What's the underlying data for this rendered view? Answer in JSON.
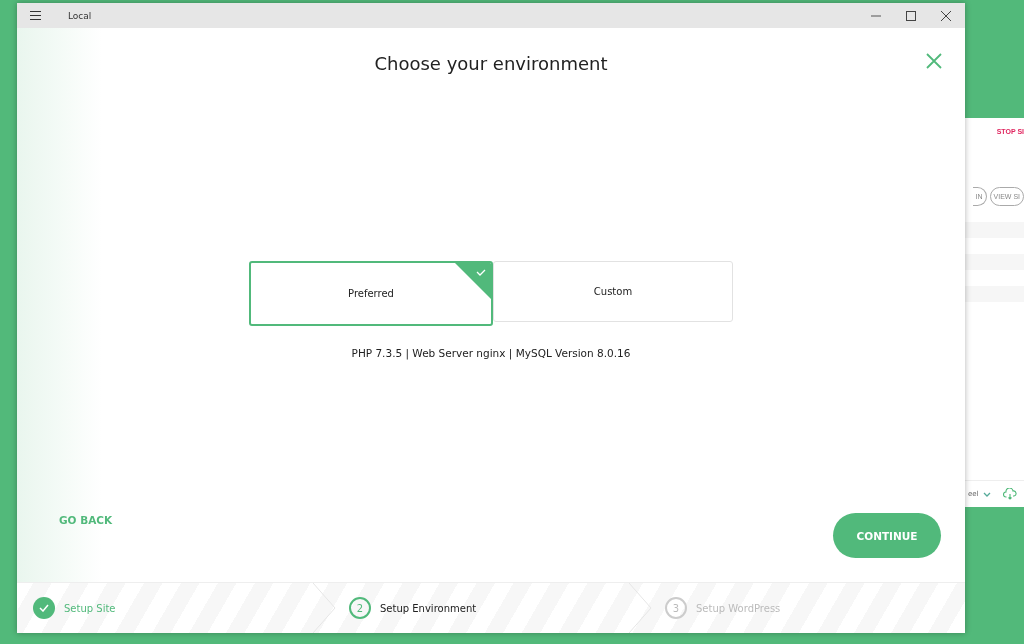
{
  "back_window": {
    "stop_link": "STOP SI",
    "buttons": [
      "IN",
      "VIEW SI"
    ],
    "footer_text": "eel"
  },
  "window": {
    "title": "Local"
  },
  "dialog": {
    "title": "Choose your environment",
    "options": [
      {
        "label": "Preferred",
        "selected": true
      },
      {
        "label": "Custom",
        "selected": false
      }
    ],
    "summary": "PHP 7.3.5 | Web Server nginx | MySQL Version 8.0.16",
    "back_button": "GO BACK",
    "continue_button": "CONTINUE"
  },
  "steps": [
    {
      "label": "Setup Site",
      "kind": "done"
    },
    {
      "number": "2",
      "label": "Setup Environment",
      "kind": "current"
    },
    {
      "number": "3",
      "label": "Setup WordPress",
      "kind": "pending"
    }
  ]
}
